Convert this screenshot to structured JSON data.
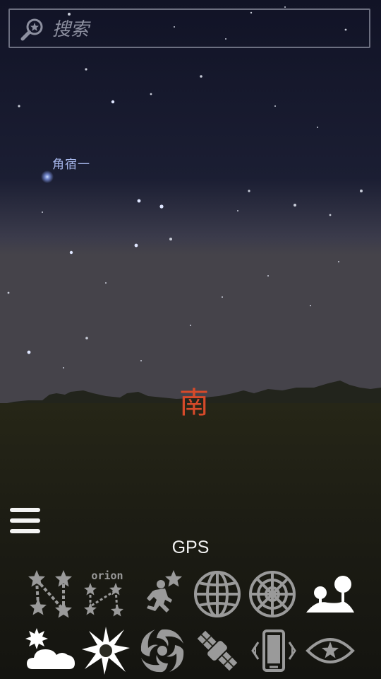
{
  "search": {
    "placeholder": "搜索"
  },
  "sky": {
    "star_label": "角宿一",
    "cardinal_direction": "南",
    "cardinal_color": "#d64a2a",
    "star_label_color": "#a7b7ec"
  },
  "menu": {
    "icon": "hamburger-menu-icon"
  },
  "location": {
    "source_label": "GPS"
  },
  "toolbar": {
    "active_color": "#ffffff",
    "inactive_color": "#9a9a9a",
    "rows": [
      [
        {
          "name": "constellation-lines-icon",
          "active": false
        },
        {
          "name": "constellation-names-icon",
          "active": false,
          "text": "orion"
        },
        {
          "name": "constellation-art-icon",
          "active": false
        },
        {
          "name": "azimuthal-grid-icon",
          "active": false
        },
        {
          "name": "equatorial-grid-icon",
          "active": false
        },
        {
          "name": "landscape-icon",
          "active": true
        }
      ],
      [
        {
          "name": "atmosphere-icon",
          "active": true
        },
        {
          "name": "deep-sky-objects-icon",
          "active": true
        },
        {
          "name": "galaxy-icon",
          "active": false
        },
        {
          "name": "satellite-icon",
          "active": false
        },
        {
          "name": "gyroscope-icon",
          "active": false
        },
        {
          "name": "night-mode-icon",
          "active": false
        }
      ]
    ]
  }
}
